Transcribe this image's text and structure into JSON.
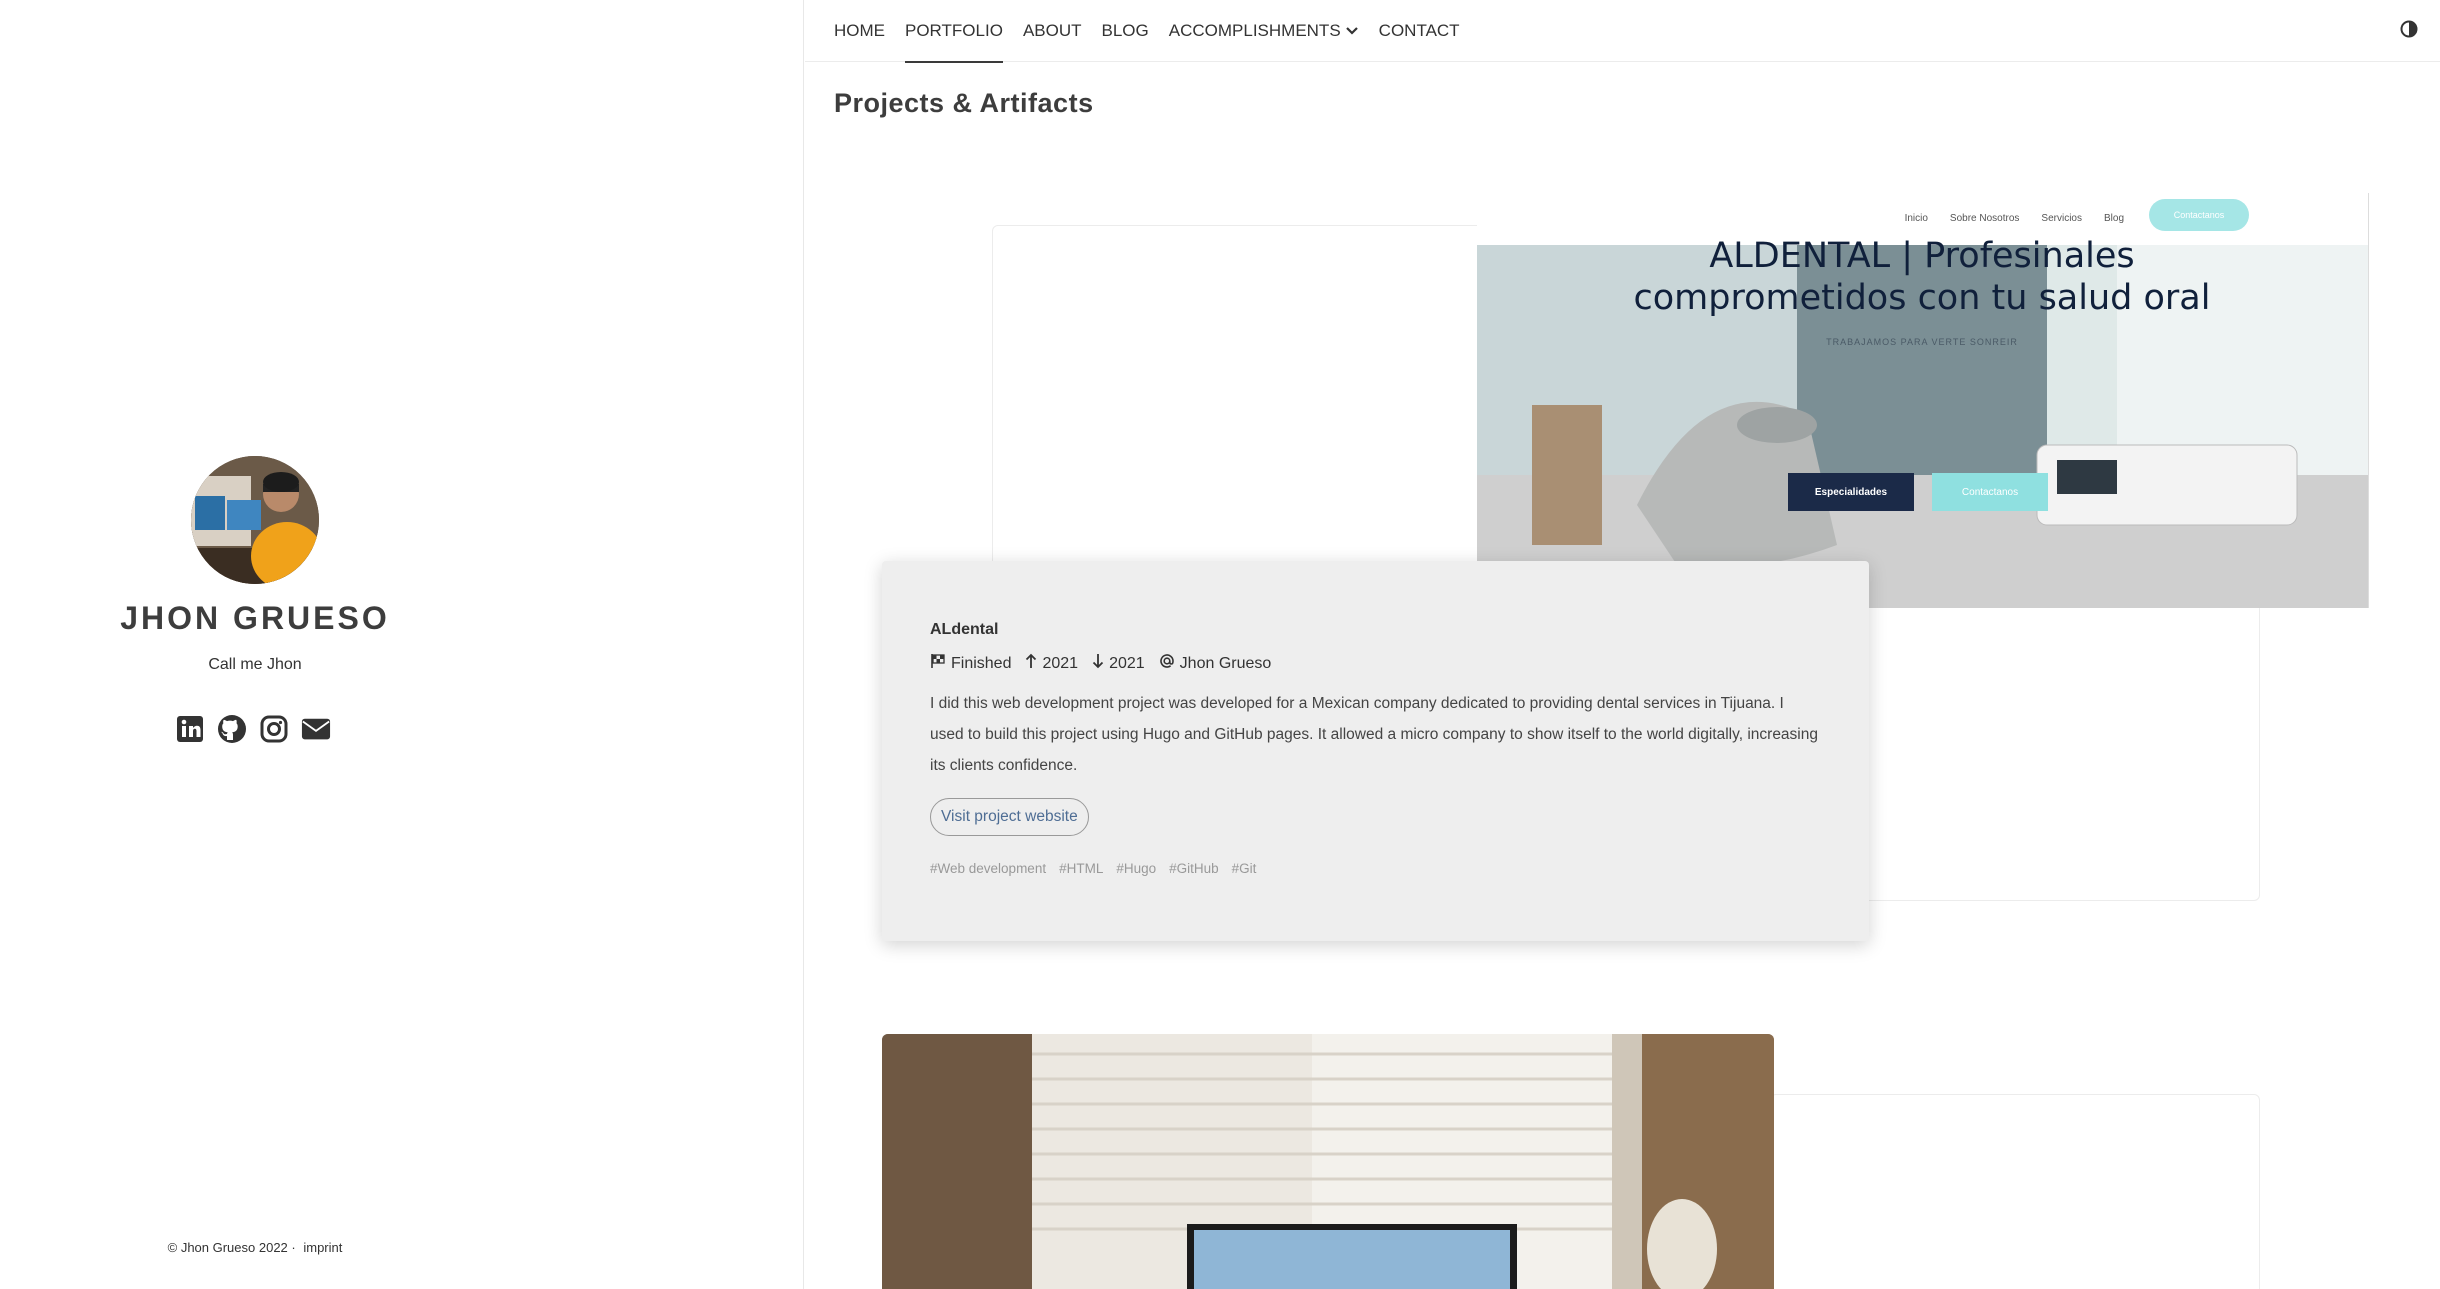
{
  "sidebar": {
    "name": "JHON GRUESO",
    "tagline": "Call me Jhon",
    "socials": [
      {
        "icon": "linkedin-icon"
      },
      {
        "icon": "github-icon"
      },
      {
        "icon": "instagram-icon"
      },
      {
        "icon": "envelope-icon"
      }
    ],
    "footer": {
      "copyright": "© Jhon Grueso 2022 ·",
      "imprint": "imprint"
    }
  },
  "nav": {
    "items": [
      {
        "label": "HOME"
      },
      {
        "label": "PORTFOLIO",
        "active": true
      },
      {
        "label": "ABOUT"
      },
      {
        "label": "BLOG"
      },
      {
        "label": "ACCOMPLISHMENTS",
        "has_dropdown": true
      },
      {
        "label": "CONTACT"
      }
    ],
    "theme_toggle_icon": "half-circle-contrast-icon"
  },
  "main": {
    "section_title": "Projects & Artifacts",
    "project": {
      "screenshot": {
        "nav_links": [
          "Inicio",
          "Sobre Nosotros",
          "Servicios",
          "Blog"
        ],
        "nav_cta": "Contactanos",
        "kicker": "TRABAJAMOS PARA VERTE SONREIR",
        "heading": "ALDENTAL | Profesinales comprometidos con tu salud oral",
        "button_primary": "Especialidades",
        "button_secondary": "Contactanos"
      },
      "title": "ALdental",
      "status": "Finished",
      "start_year": "2021",
      "end_year": "2021",
      "author": "Jhon Grueso",
      "description": "I did this web development project was developed for a Mexican company dedicated to providing dental services in Tijuana. I used to build this project using Hugo and GitHub pages. It allowed a micro company to show itself to the world digitally, increasing its clients confidence.",
      "visit_label": "Visit project website",
      "tags": [
        "#Web development",
        "#HTML",
        "#Hugo",
        "#GitHub",
        "#Git"
      ]
    }
  },
  "colors": {
    "accent_link": "#4e6d94",
    "card_bg": "#eeeeee",
    "text": "#333333"
  }
}
